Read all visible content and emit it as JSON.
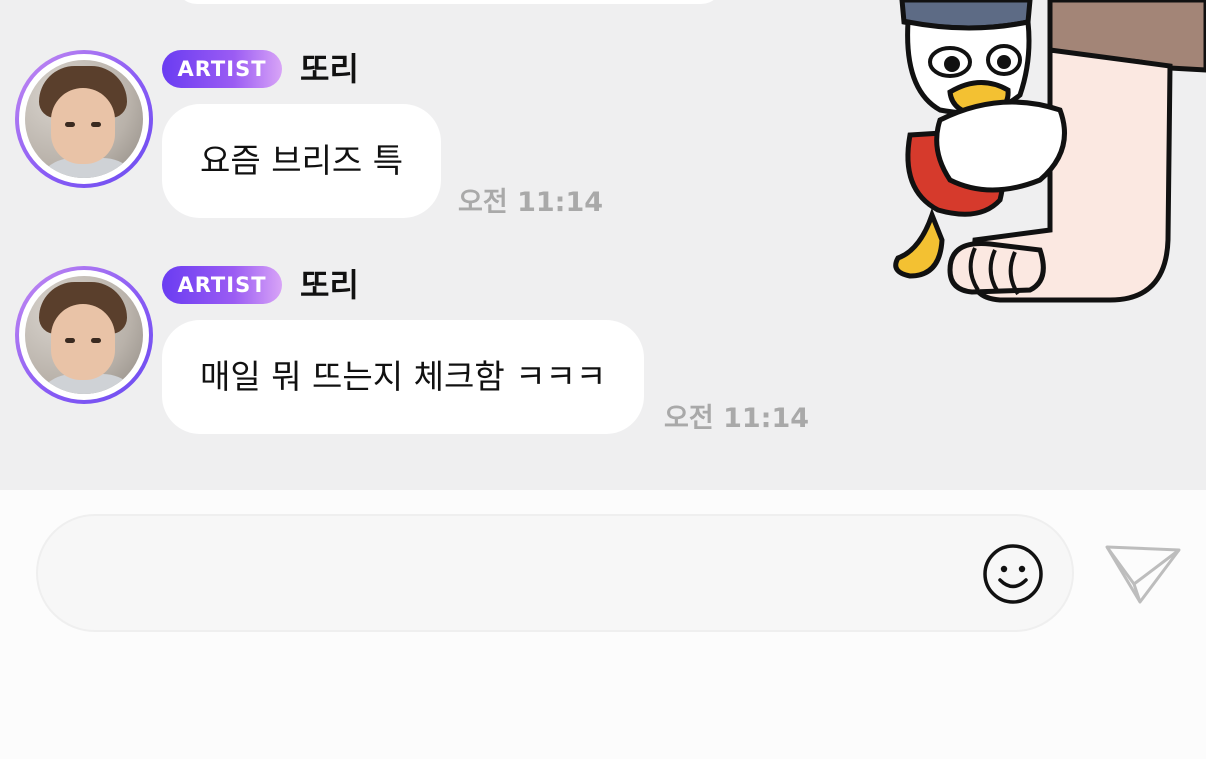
{
  "messages": [
    {
      "badge": "ARTIST",
      "sender": "또리",
      "text": "요즘 브리즈 특",
      "time": "오전 11:14"
    },
    {
      "badge": "ARTIST",
      "sender": "또리",
      "text": "매일 뭐 뜨는지 체크함 ㅋㅋㅋ",
      "time": "오전 11:14"
    }
  ],
  "composer": {
    "value": "",
    "placeholder": ""
  },
  "icons": {
    "emoji": "smiley-icon",
    "send": "paper-plane-icon"
  }
}
